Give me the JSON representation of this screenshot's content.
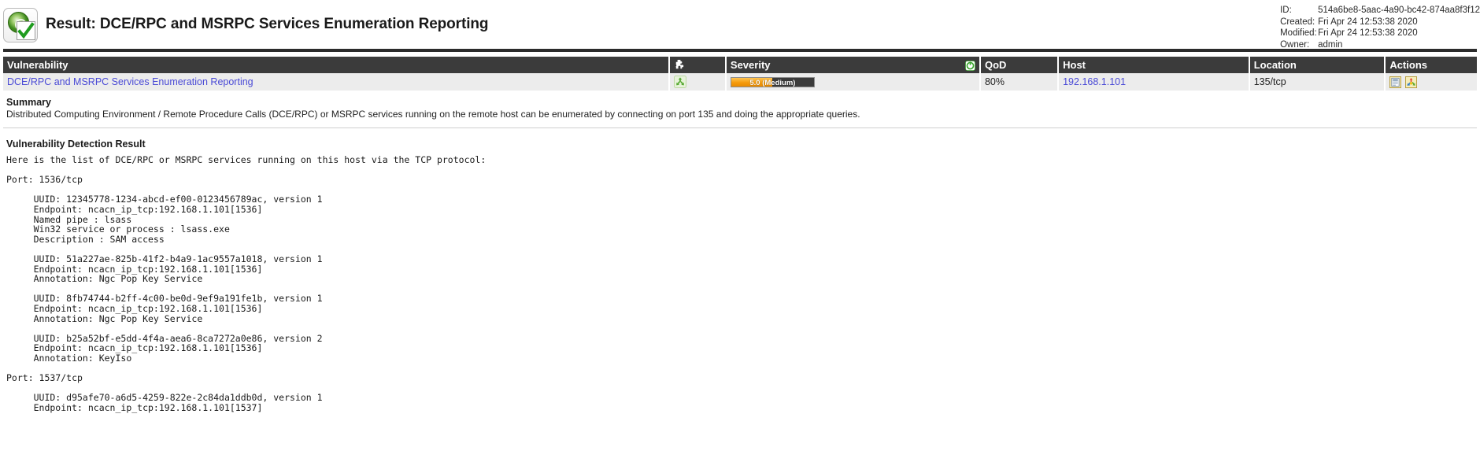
{
  "header": {
    "icon_name": "scan-result-icon",
    "title": "Result: DCE/RPC and MSRPC Services Enumeration Reporting",
    "meta": {
      "id_label": "ID:",
      "id_value": "514a6be8-5aac-4a90-bc42-874aa8f3f12",
      "created_label": "Created:",
      "created_value": "Fri Apr 24 12:53:38 2020",
      "modified_label": "Modified:",
      "modified_value": "Fri Apr 24 12:53:38 2020",
      "owner_label": "Owner:",
      "owner_value": "admin"
    }
  },
  "table": {
    "columns": {
      "vulnerability": "Vulnerability",
      "solution_type_icon": "puzzle-piece-icon",
      "severity": "Severity",
      "severity_sort_icon": "qod-circle-icon",
      "qod": "QoD",
      "host": "Host",
      "location": "Location",
      "actions": "Actions"
    },
    "rows": [
      {
        "vulnerability": "DCE/RPC and MSRPC Services Enumeration Reporting",
        "solution_type_icon": "recycle-green-icon",
        "severity_value": "5.0 (Medium)",
        "severity_score": 5.0,
        "severity_max": 10.0,
        "severity_percent": 50,
        "severity_color": "#f59a0b",
        "qod": "80%",
        "host": "192.168.1.101",
        "location": "135/tcp",
        "actions": [
          "add-note-icon",
          "add-override-icon"
        ]
      }
    ]
  },
  "summary": {
    "title": "Summary",
    "text": "Distributed Computing Environment / Remote Procedure Calls (DCE/RPC) or MSRPC services running on the remote host can be enumerated by connecting on port 135 and doing the appropriate queries."
  },
  "detection": {
    "title": "Vulnerability Detection Result",
    "text": "Here is the list of DCE/RPC or MSRPC services running on this host via the TCP protocol:\n\nPort: 1536/tcp\n\n     UUID: 12345778-1234-abcd-ef00-0123456789ac, version 1\n     Endpoint: ncacn_ip_tcp:192.168.1.101[1536]\n     Named pipe : lsass\n     Win32 service or process : lsass.exe\n     Description : SAM access\n\n     UUID: 51a227ae-825b-41f2-b4a9-1ac9557a1018, version 1\n     Endpoint: ncacn_ip_tcp:192.168.1.101[1536]\n     Annotation: Ngc Pop Key Service\n\n     UUID: 8fb74744-b2ff-4c00-be0d-9ef9a191fe1b, version 1\n     Endpoint: ncacn_ip_tcp:192.168.1.101[1536]\n     Annotation: Ngc Pop Key Service\n\n     UUID: b25a52bf-e5dd-4f4a-aea6-8ca7272a0e86, version 2\n     Endpoint: ncacn_ip_tcp:192.168.1.101[1536]\n     Annotation: KeyIso\n\nPort: 1537/tcp\n\n     UUID: d95afe70-a6d5-4259-822e-2c84da1ddb0d, version 1\n     Endpoint: ncacn_ip_tcp:192.168.1.101[1537]"
  },
  "colors": {
    "header_bar": "#3b3b3b",
    "row_bg": "#ececec",
    "link": "#4a4ad6",
    "severity_medium": "#f59a0b"
  }
}
